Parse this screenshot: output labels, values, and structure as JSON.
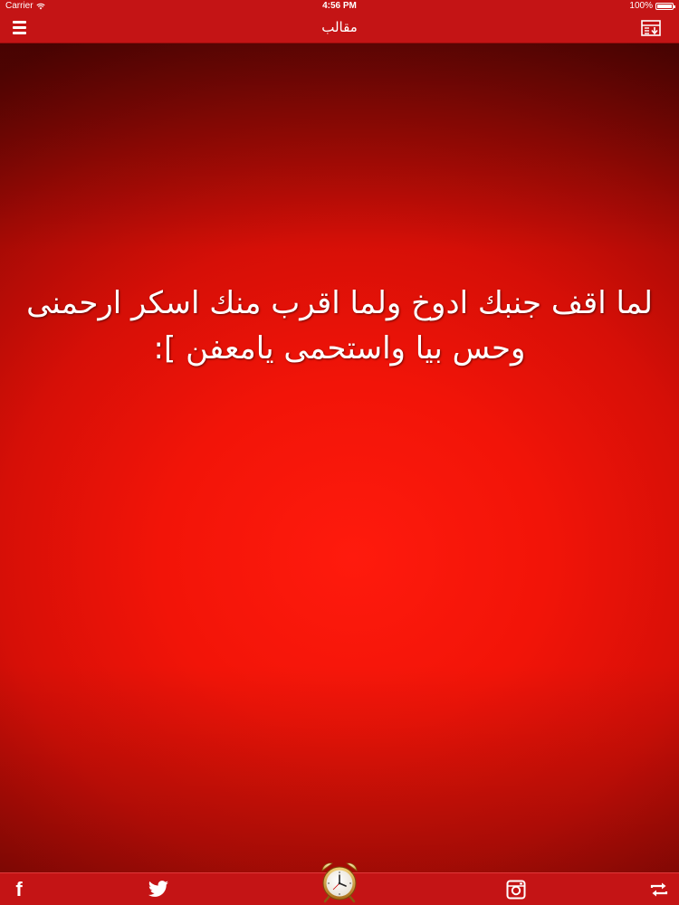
{
  "status_bar": {
    "carrier": "Carrier",
    "time": "4:56 PM",
    "battery": "100%"
  },
  "nav": {
    "title": "مقالب"
  },
  "message": {
    "lines": [
      "لما اقف جنبك ادوخ ولما اقرب منك اسكر ارحمنى",
      "وحس بيا واستحمى يامعفن ]:"
    ]
  },
  "bottom_bar": {
    "facebook_glyph": "f",
    "icons": [
      "facebook-icon",
      "twitter-icon",
      "alarm-clock-icon",
      "instagram-icon",
      "repeat-icon"
    ]
  },
  "colors": {
    "bar": "#c41415",
    "background_center": "#ff1a0d",
    "background_edge": "#6e0503",
    "text": "#ffffff"
  }
}
